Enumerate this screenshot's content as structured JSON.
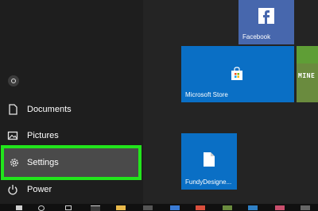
{
  "start_menu": {
    "items": [
      {
        "label": "Documents",
        "icon": "document-icon"
      },
      {
        "label": "Pictures",
        "icon": "picture-icon"
      },
      {
        "label": "Settings",
        "icon": "gear-icon",
        "highlighted": true
      },
      {
        "label": "Power",
        "icon": "power-icon"
      }
    ],
    "highlight_color": "#22e51c"
  },
  "tiles": {
    "facebook": {
      "label": "Facebook",
      "icon": "facebook-icon",
      "color": "#4767ad"
    },
    "store": {
      "label": "Microsoft Store",
      "icon": "shopping-bag-icon",
      "color": "#0a6fc5"
    },
    "minecraft": {
      "label": "MINE",
      "icon": "minecraft-icon"
    },
    "fundy": {
      "label": "FundyDesigne...",
      "icon": "file-icon",
      "color": "#0a6fc5"
    }
  }
}
